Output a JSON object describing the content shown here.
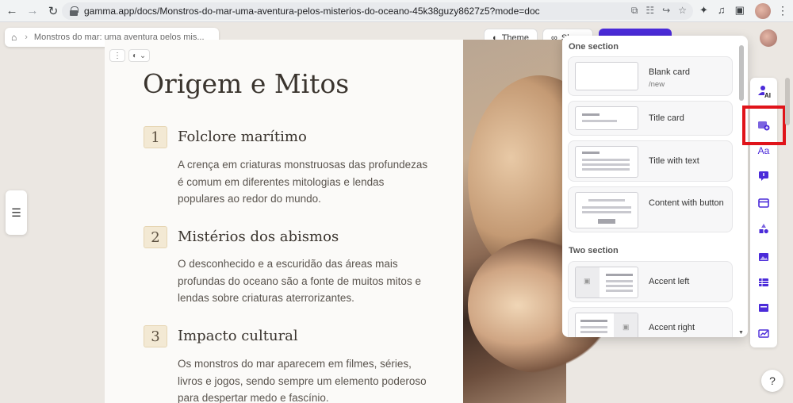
{
  "browser": {
    "url": "gamma.app/docs/Monstros-do-mar-uma-aventura-pelos-misterios-do-oceano-45k38guzy8627z5?mode=doc"
  },
  "topbar": {
    "breadcrumb": "Monstros do mar: uma aventura pelos mis...",
    "theme_label": "Theme",
    "share_label": "Sh"
  },
  "card": {
    "title": "Origem e Mitos",
    "items": [
      {
        "num": "1",
        "title": "Folclore marítimo",
        "text": "A crença em criaturas monstruosas das profundezas é comum em diferentes mitologias e lendas populares ao redor do mundo."
      },
      {
        "num": "2",
        "title": "Mistérios dos abismos",
        "text": "O desconhecido e a escuridão das áreas mais profundas do oceano são a fonte de muitos mitos e lendas sobre criaturas aterrorizantes."
      },
      {
        "num": "3",
        "title": "Impacto cultural",
        "text": "Os monstros do mar aparecem em filmes, séries, livros e jogos, sendo sempre um elemento poderoso para despertar medo e fascínio."
      }
    ]
  },
  "panel": {
    "section_one": "One section",
    "section_two": "Two section",
    "templates": [
      {
        "label": "Blank card",
        "sub": "/new"
      },
      {
        "label": "Title card",
        "sub": ""
      },
      {
        "label": "Title with text",
        "sub": ""
      },
      {
        "label": "Content with button",
        "sub": ""
      },
      {
        "label": "Accent left",
        "sub": ""
      },
      {
        "label": "Accent right",
        "sub": ""
      }
    ]
  },
  "rail": {
    "ai_badge": "AI",
    "text_icon": "Aa",
    "icons": [
      "ai-user-icon",
      "card-add-icon",
      "text-style-icon",
      "callout-icon",
      "layout-icon",
      "shapes-icon",
      "image-icon",
      "table-icon",
      "embed-icon",
      "chart-icon"
    ]
  },
  "help_label": "?",
  "colors": {
    "accent": "#4b2bd9",
    "highlight": "#e0141a",
    "number_badge": "#f3e9d4"
  }
}
